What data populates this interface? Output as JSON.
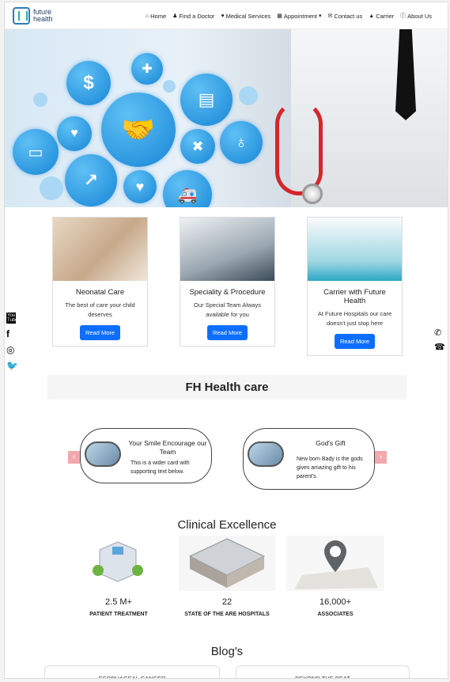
{
  "brand": {
    "line1": "future",
    "line2": "health"
  },
  "nav": [
    {
      "icon": "home-icon",
      "glyph": "⌂",
      "label": "Home"
    },
    {
      "icon": "doctor-icon",
      "glyph": "♟",
      "label": "Find a Doctor"
    },
    {
      "icon": "medical-services-icon",
      "glyph": "♥",
      "label": "Medical Services"
    },
    {
      "icon": "calendar-icon",
      "glyph": "▦",
      "label": "Appointment"
    },
    {
      "icon": "contact-icon",
      "glyph": "✉",
      "label": "Contact us"
    },
    {
      "icon": "graduation-cap-icon",
      "glyph": "▲",
      "label": "Carrier"
    },
    {
      "icon": "info-icon",
      "glyph": "ⓘ",
      "label": "About Us"
    }
  ],
  "cards": [
    {
      "title": "Neonatal Care",
      "text": "The best of care your child deserves",
      "button": "Read More"
    },
    {
      "title": "Speciality & Procedure",
      "text": "Our Special Team Always available for you",
      "button": "Read More"
    },
    {
      "title": "Carrier with Future Health",
      "text": "At Future Hospitals our care doesn't just stop here",
      "button": "Read More"
    }
  ],
  "section_title": "FH Health care",
  "testimonials": [
    {
      "title": "Your Smile Encourage our Team",
      "text": "This is a wider card with supporting text below."
    },
    {
      "title": "God's Gift",
      "text": "New born Bady is the gods gives amazing gift to his parent's."
    }
  ],
  "excellence_title": "Clinical Excellence",
  "stats": [
    {
      "value": "2.5 M+",
      "label": "PATIENT TREATMENT"
    },
    {
      "value": "22",
      "label": "STATE OF THE ARE HOSPITALS"
    },
    {
      "value": "16,000+",
      "label": "ASSOCIATES"
    }
  ],
  "blogs_title": "Blog's",
  "blogs": [
    {
      "title": "ESOPHAGEAL CANCER"
    },
    {
      "title": "BEYOND THE BEAT"
    }
  ],
  "social": {
    "youtube": "You Tube"
  },
  "colors": {
    "accent": "#0d6efd",
    "arrow": "#f2a9ae",
    "hero_blue": "#1786d6"
  }
}
